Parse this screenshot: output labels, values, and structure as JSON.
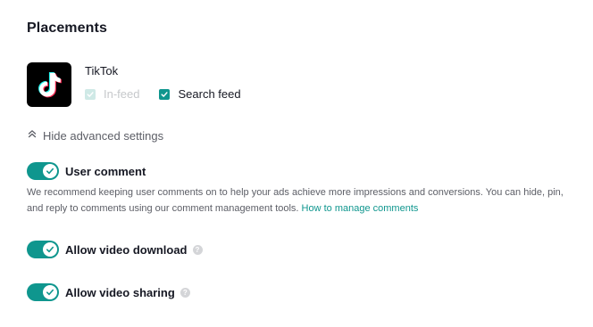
{
  "section": {
    "title": "Placements"
  },
  "placement": {
    "app_name": "TikTok",
    "logo_icon": "tiktok-logo-icon",
    "options": [
      {
        "label": "In-feed",
        "checked": true,
        "disabled": true
      },
      {
        "label": "Search feed",
        "checked": true,
        "disabled": false
      }
    ]
  },
  "advanced": {
    "label": "Hide advanced settings",
    "icon": "double-chevron-up-icon"
  },
  "user_comment": {
    "label": "User comment",
    "enabled": true,
    "description": "We recommend keeping user comments on to help your ads achieve more impressions and conversions. You can hide, pin, and reply to comments using our comment management tools.",
    "link_text": "How to manage comments"
  },
  "video_download": {
    "label": "Allow video download",
    "enabled": true,
    "help_icon": "question-icon"
  },
  "video_sharing": {
    "label": "Allow video sharing",
    "enabled": true,
    "help_icon": "question-icon"
  },
  "colors": {
    "accent": "#0f968e",
    "text": "#161823",
    "muted": "#5c5e66"
  }
}
